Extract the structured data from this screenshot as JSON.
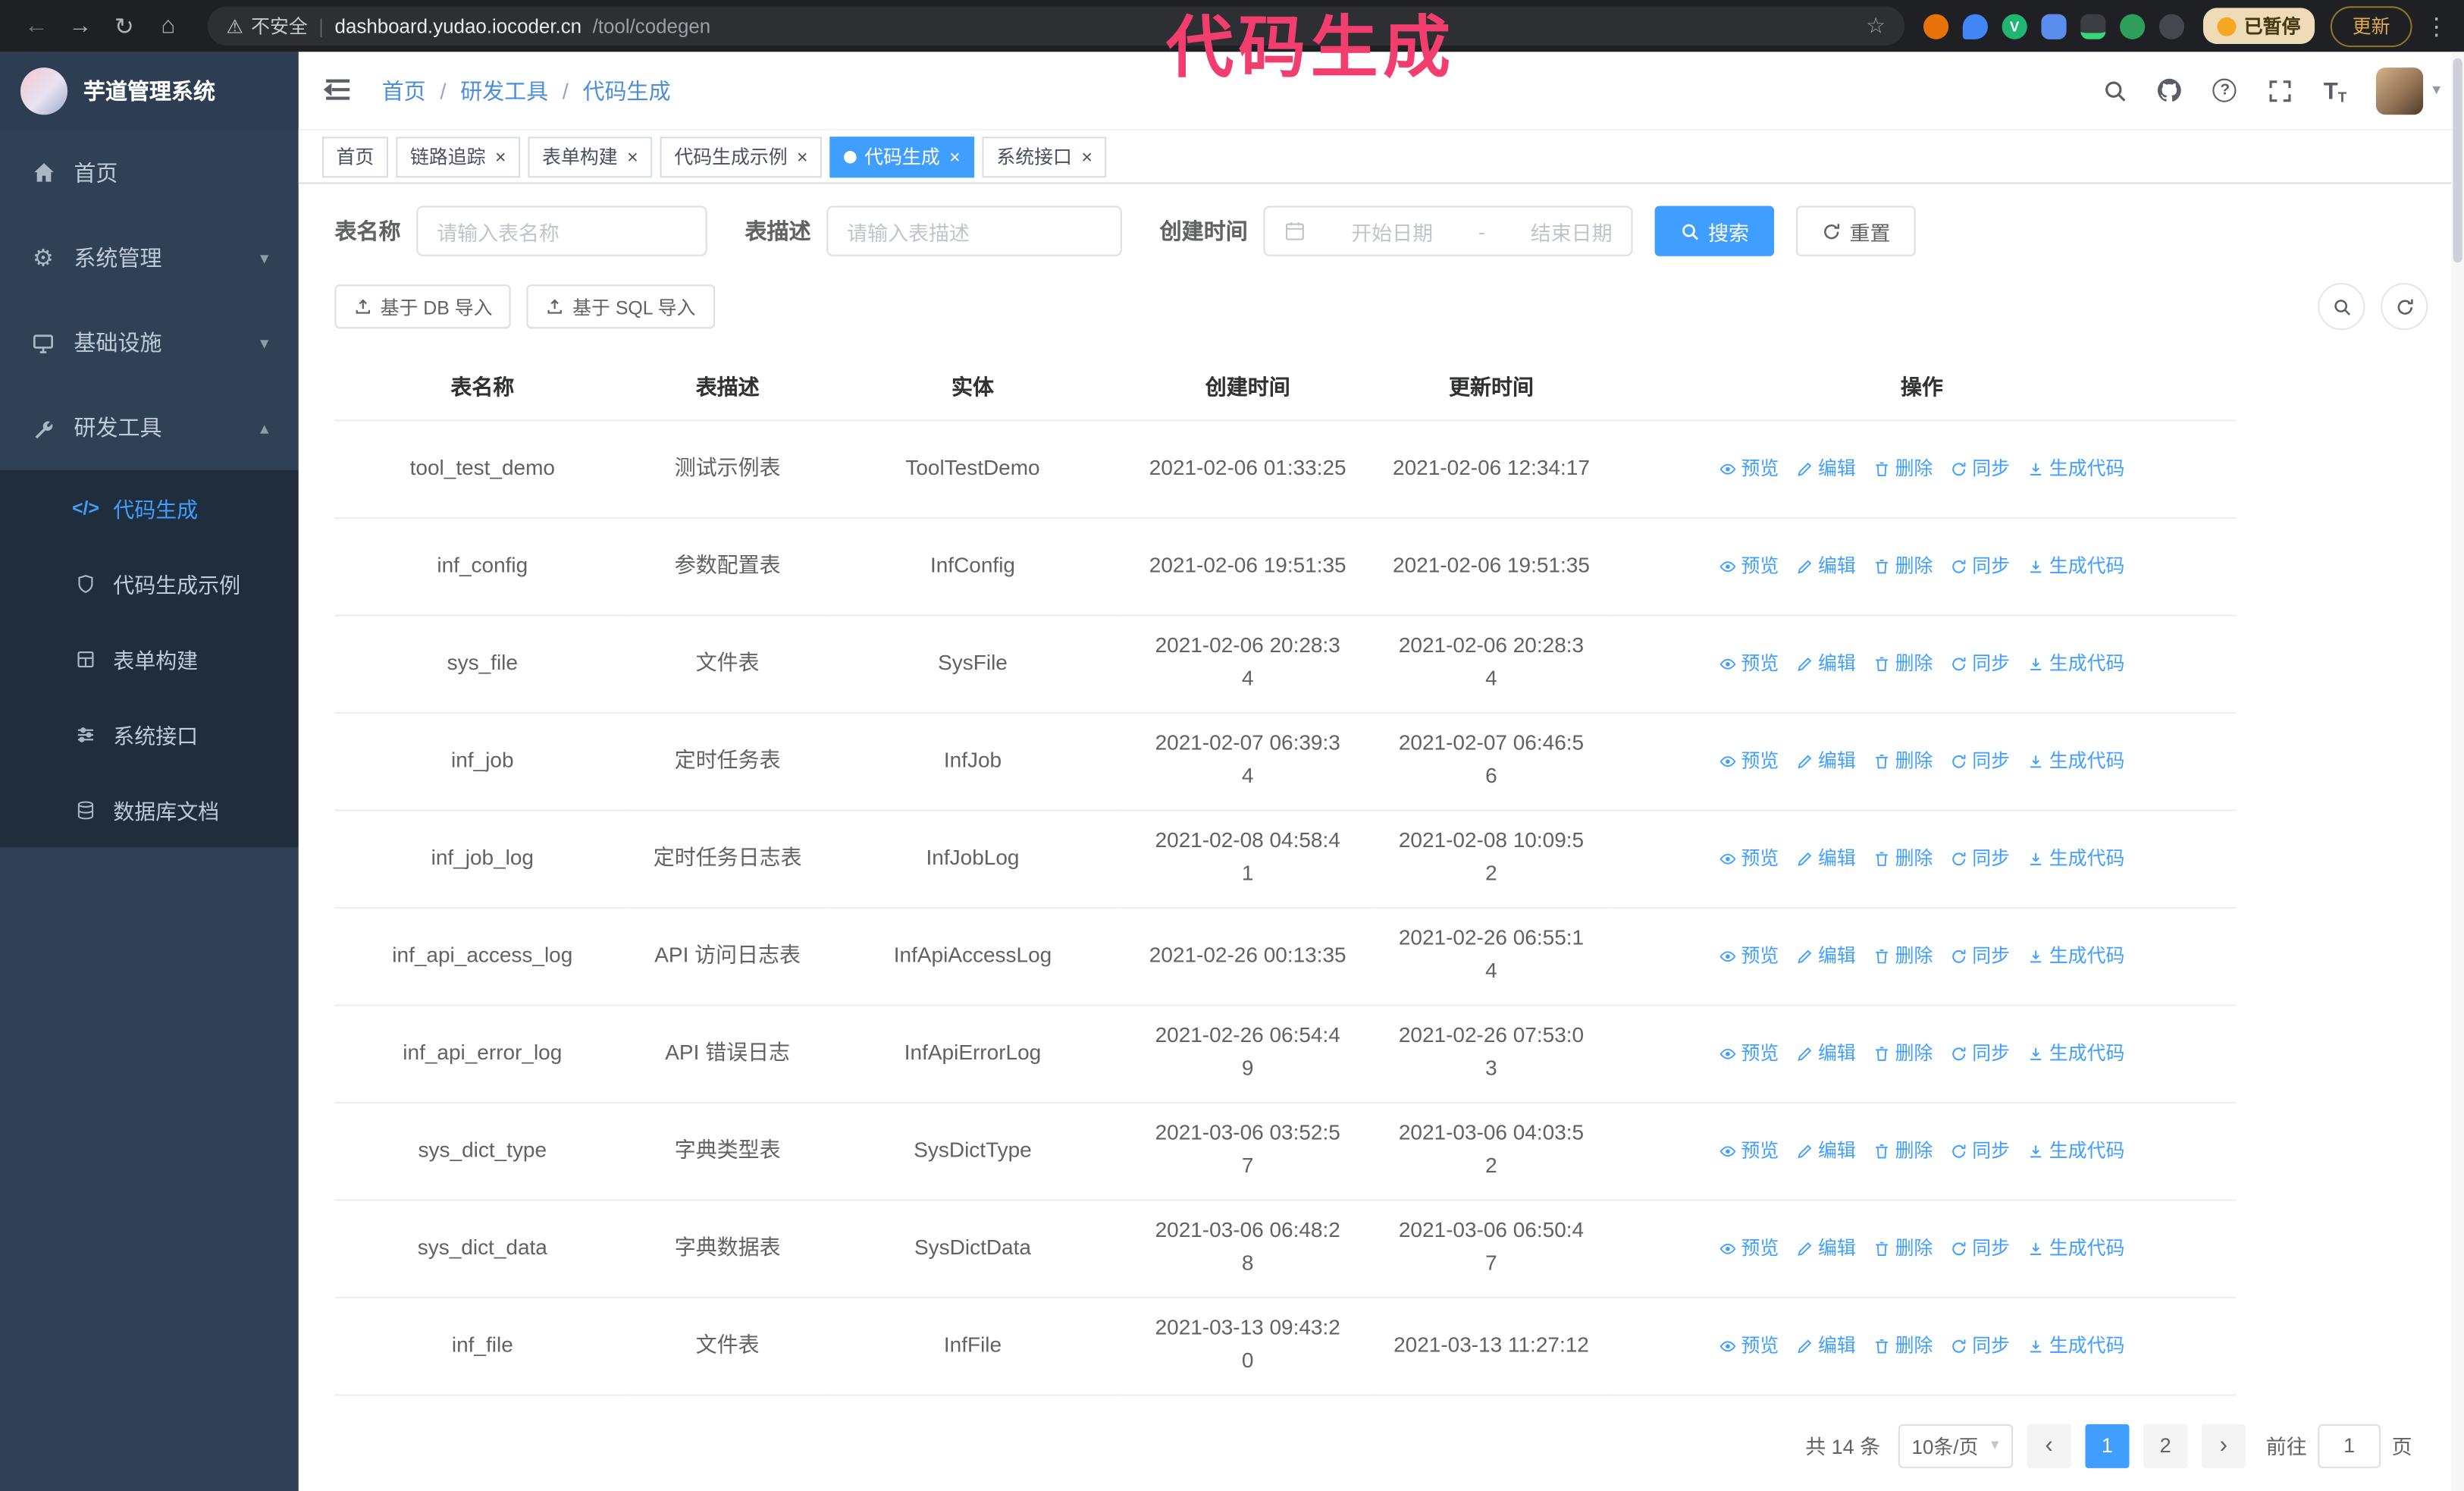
{
  "colors": {
    "accent": "#409eff",
    "sidebar_bg": "#304156",
    "submenu_bg": "#1f2d3d",
    "annotation": "#f23e6e",
    "tag_active": "#409eff"
  },
  "icons": {
    "back": "←",
    "forward": "→",
    "reload": "↻",
    "browser_home": "⌂",
    "warning": "⚠",
    "pipe": "|",
    "star": "☆",
    "menu_dots": "⋮",
    "gear": "⚙",
    "chevron_down": "▾",
    "chevron_up": "▴",
    "caret_down": "▾",
    "question": "?",
    "code": "</>",
    "close": "×",
    "prev": "‹",
    "next": "›",
    "font_size_glyph": "T"
  },
  "browser": {
    "security_label": "不安全",
    "url_host": "dashboard.yudao.iocoder.cn",
    "url_path": "/tool/codegen",
    "paused_badge": "已暂停",
    "update_button": "更新"
  },
  "annotation": "代码生成",
  "sidebar": {
    "logo_title": "芋道管理系统",
    "items": [
      {
        "label": "首页"
      },
      {
        "label": "系统管理"
      },
      {
        "label": "基础设施"
      },
      {
        "label": "研发工具"
      }
    ],
    "sub_items": [
      {
        "label": "代码生成",
        "active": true
      },
      {
        "label": "代码生成示例"
      },
      {
        "label": "表单构建"
      },
      {
        "label": "系统接口"
      },
      {
        "label": "数据库文档"
      }
    ]
  },
  "header": {
    "breadcrumb": [
      "首页",
      "研发工具",
      "代码生成"
    ],
    "separator": "/"
  },
  "tabs": [
    {
      "label": "首页",
      "closable": false,
      "active": false
    },
    {
      "label": "链路追踪",
      "closable": true,
      "active": false
    },
    {
      "label": "表单构建",
      "closable": true,
      "active": false
    },
    {
      "label": "代码生成示例",
      "closable": true,
      "active": false
    },
    {
      "label": "代码生成",
      "closable": true,
      "active": true
    },
    {
      "label": "系统接口",
      "closable": true,
      "active": false
    }
  ],
  "filters": {
    "table_name_label": "表名称",
    "table_name_placeholder": "请输入表名称",
    "table_desc_label": "表描述",
    "table_desc_placeholder": "请输入表描述",
    "create_time_label": "创建时间",
    "date_start_placeholder": "开始日期",
    "date_separator": "-",
    "date_end_placeholder": "结束日期",
    "search_button": "搜索",
    "reset_button": "重置"
  },
  "toolbar": {
    "import_db": "基于 DB 导入",
    "import_sql": "基于 SQL 导入"
  },
  "table": {
    "columns": [
      "表名称",
      "表描述",
      "实体",
      "创建时间",
      "更新时间",
      "操作"
    ],
    "actions": [
      {
        "label": "预览",
        "icon": "eye"
      },
      {
        "label": "编辑",
        "icon": "edit"
      },
      {
        "label": "删除",
        "icon": "delete"
      },
      {
        "label": "同步",
        "icon": "sync"
      },
      {
        "label": "生成代码",
        "icon": "download"
      }
    ],
    "rows": [
      {
        "name": "tool_test_demo",
        "desc": "测试示例表",
        "entity": "ToolTestDemo",
        "created": "2021-02-06 01:33:25",
        "updated": "2021-02-06 12:34:17"
      },
      {
        "name": "inf_config",
        "desc": "参数配置表",
        "entity": "InfConfig",
        "created": "2021-02-06 19:51:35",
        "updated": "2021-02-06 19:51:35"
      },
      {
        "name": "sys_file",
        "desc": "文件表",
        "entity": "SysFile",
        "created": "2021-02-06 20:28:3\n4",
        "updated": "2021-02-06 20:28:3\n4"
      },
      {
        "name": "inf_job",
        "desc": "定时任务表",
        "entity": "InfJob",
        "created": "2021-02-07 06:39:3\n4",
        "updated": "2021-02-07 06:46:5\n6"
      },
      {
        "name": "inf_job_log",
        "desc": "定时任务日志表",
        "entity": "InfJobLog",
        "created": "2021-02-08 04:58:4\n1",
        "updated": "2021-02-08 10:09:5\n2"
      },
      {
        "name": "inf_api_access_log",
        "desc": "API 访问日志表",
        "entity": "InfApiAccessLog",
        "created": "2021-02-26 00:13:35",
        "updated": "2021-02-26 06:55:1\n4"
      },
      {
        "name": "inf_api_error_log",
        "desc": "API 错误日志",
        "entity": "InfApiErrorLog",
        "created": "2021-02-26 06:54:4\n9",
        "updated": "2021-02-26 07:53:0\n3"
      },
      {
        "name": "sys_dict_type",
        "desc": "字典类型表",
        "entity": "SysDictType",
        "created": "2021-03-06 03:52:5\n7",
        "updated": "2021-03-06 04:03:5\n2"
      },
      {
        "name": "sys_dict_data",
        "desc": "字典数据表",
        "entity": "SysDictData",
        "created": "2021-03-06 06:48:2\n8",
        "updated": "2021-03-06 06:50:4\n7"
      },
      {
        "name": "inf_file",
        "desc": "文件表",
        "entity": "InfFile",
        "created": "2021-03-13 09:43:2\n0",
        "updated": "2021-03-13 11:27:12"
      }
    ]
  },
  "pagination": {
    "total": "共 14 条",
    "page_size": "10条/页",
    "pages": [
      "1",
      "2"
    ],
    "goto_label": "前往",
    "goto_value": "1",
    "goto_suffix": "页"
  }
}
